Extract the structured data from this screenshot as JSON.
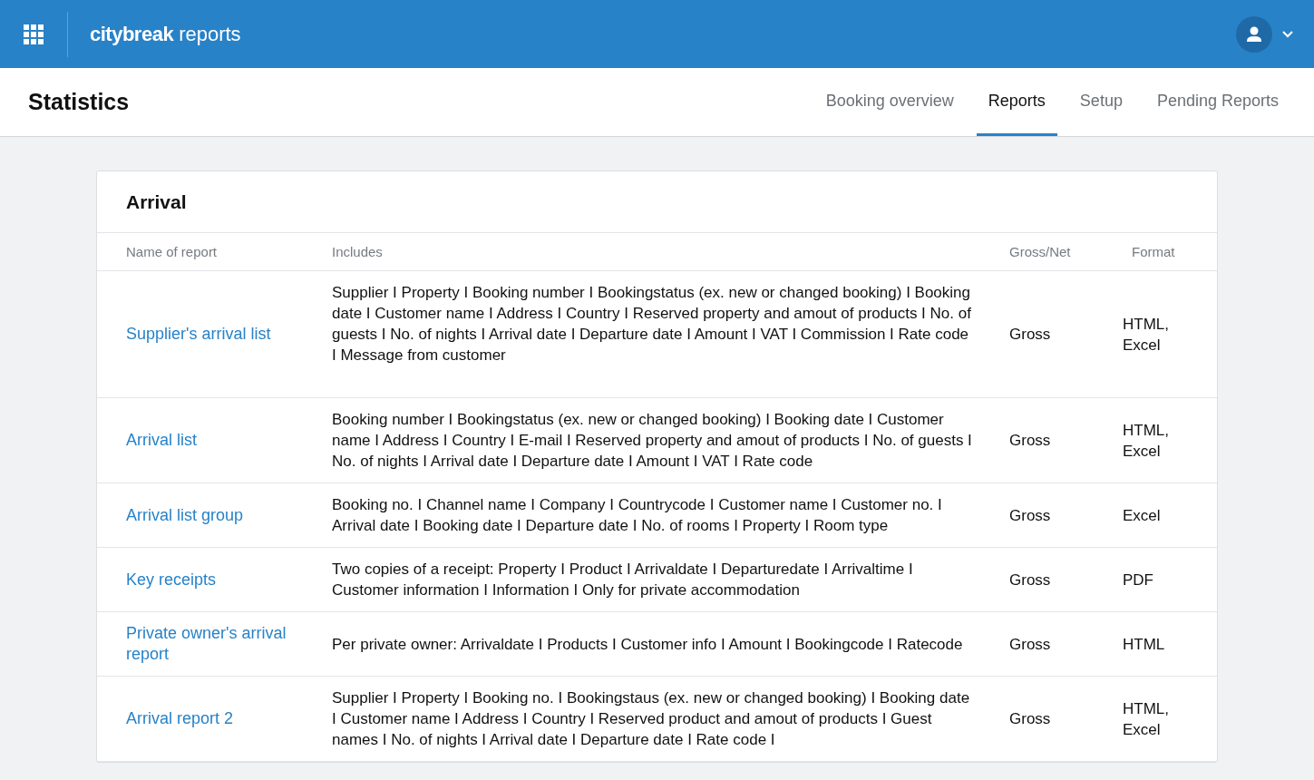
{
  "app_bar": {
    "brand_bold": "citybreak",
    "brand_light": "reports"
  },
  "page": {
    "title": "Statistics"
  },
  "tabs": [
    {
      "label": "Booking overview",
      "selected": false
    },
    {
      "label": "Reports",
      "selected": true
    },
    {
      "label": "Setup",
      "selected": false
    },
    {
      "label": "Pending Reports",
      "selected": false
    }
  ],
  "card": {
    "title": "Arrival",
    "columns": [
      "Name of report",
      "Includes",
      "Gross/Net",
      "Format"
    ],
    "rows": [
      {
        "name": "Supplier's arrival list",
        "includes": "Supplier I Property I Booking number I Bookingstatus (ex. new or changed booking) I Booking date I Customer name I Address I Country I Reserved property and amout of products I No. of guests I No. of nights I Arrival date I Departure date I Amount I VAT I Commission I Rate code I Message from customer",
        "gross_net": "Gross",
        "format": "HTML, Excel"
      },
      {
        "name": "Arrival list",
        "includes": "Booking number I Bookingstatus (ex. new or changed booking) I Booking date I Customer name I Address I Country I E-mail I Reserved property and amout of products I No. of guests I No. of nights I Arrival date I Departure date I Amount I VAT I Rate code",
        "gross_net": "Gross",
        "format": "HTML, Excel"
      },
      {
        "name": "Arrival list group",
        "includes": "Booking no. I Channel name I Company I Countrycode I Customer name I Customer no. I Arrival date I Booking date I Departure date I No. of rooms I Property I Room type",
        "gross_net": "Gross",
        "format": "Excel"
      },
      {
        "name": "Key receipts",
        "includes": "Two copies of a receipt: Property I Product I Arrivaldate I Departuredate I Arrivaltime I Customer information I Information I Only for private accommodation",
        "gross_net": "Gross",
        "format": "PDF"
      },
      {
        "name": "Private owner's arrival report",
        "includes": "Per private owner: Arrivaldate I Products I Customer info I Amount I Bookingcode I Ratecode",
        "gross_net": "Gross",
        "format": "HTML"
      },
      {
        "name": "Arrival report 2",
        "includes": "Supplier I Property I Booking no. I Bookingstaus (ex. new or changed booking) I Booking date I Customer name I Address I Country I Reserved product and amout of products I Guest names I No. of nights I Arrival date I Departure date I Rate code I",
        "gross_net": "Gross",
        "format": "HTML, Excel"
      }
    ]
  }
}
